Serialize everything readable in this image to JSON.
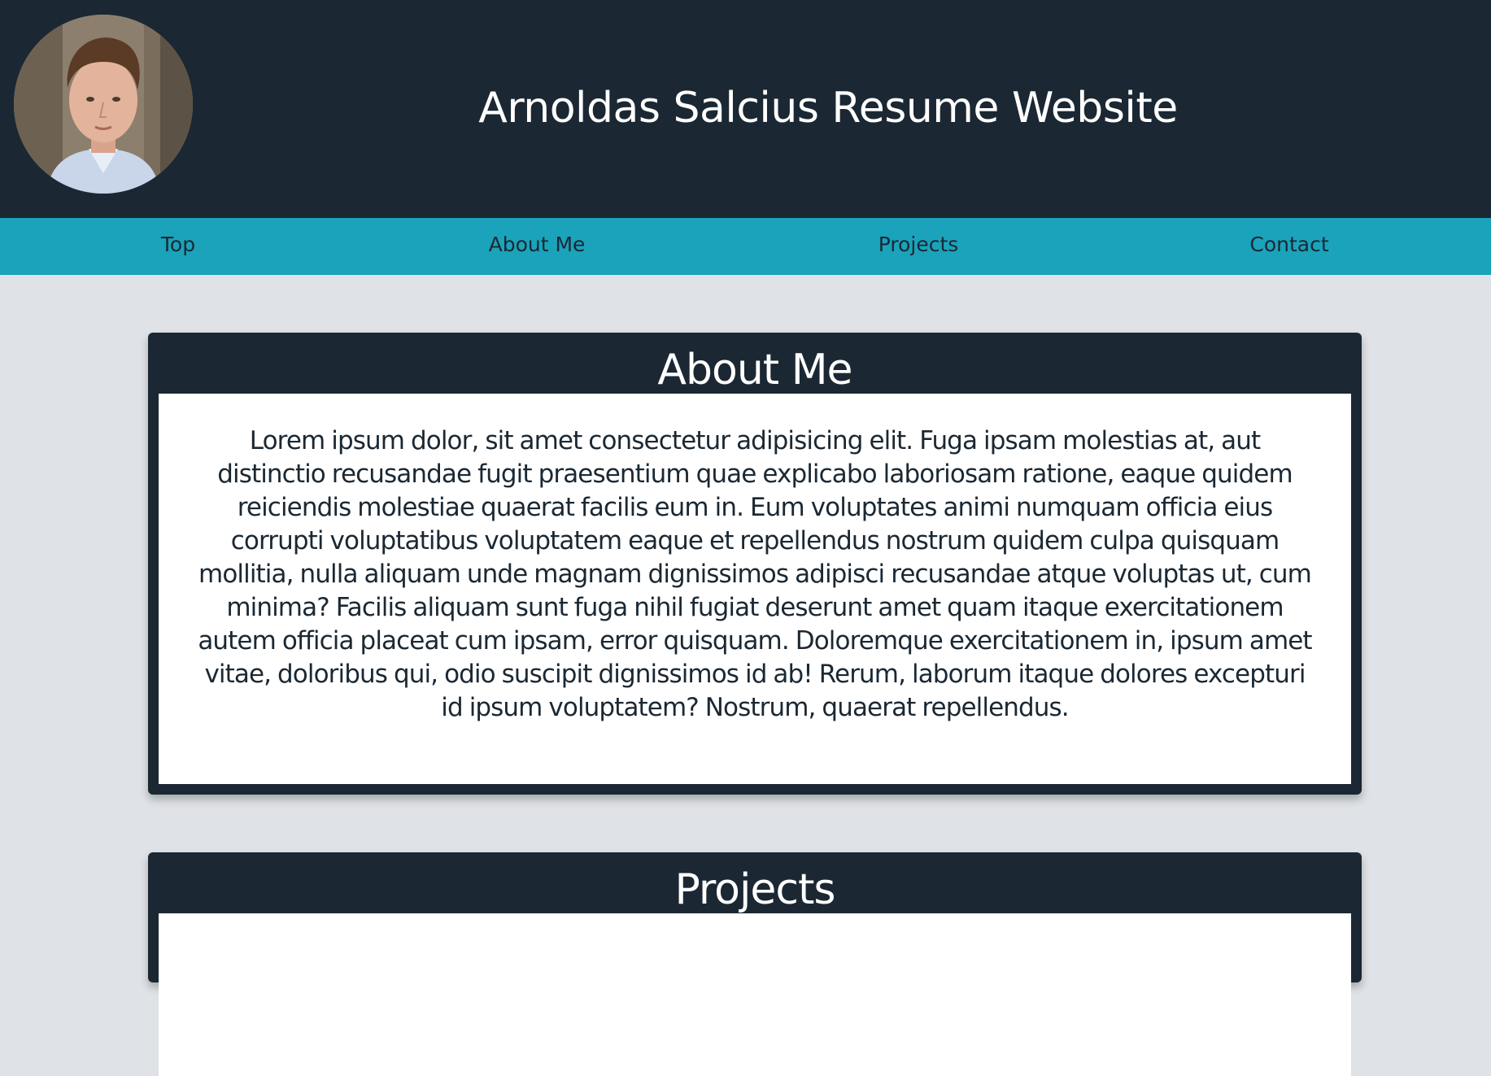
{
  "header": {
    "title": "Arnoldas Salcius Resume Website",
    "avatar_alt": "profile photo"
  },
  "nav": {
    "items": [
      {
        "label": "Top"
      },
      {
        "label": "About Me"
      },
      {
        "label": "Projects"
      },
      {
        "label": "Contact"
      }
    ]
  },
  "about": {
    "title": "About Me",
    "text": "Lorem ipsum dolor, sit amet consectetur adipisicing elit. Fuga ipsam molestias at, aut distinctio recusandae fugit praesentium quae explicabo laboriosam ratione, eaque quidem reiciendis molestiae quaerat facilis eum in. Eum voluptates animi numquam officia eius corrupti voluptatibus voluptatem eaque et repellendus nostrum quidem culpa quisquam mollitia, nulla aliquam unde magnam dignissimos adipisci recusandae atque voluptas ut, cum minima? Facilis aliquam sunt fuga nihil fugiat deserunt amet quam itaque exercitationem autem officia placeat cum ipsam, error quisquam. Doloremque exercitationem in, ipsum amet vitae, doloribus qui, odio suscipit dignissimos id ab! Rerum, laborum itaque dolores excepturi id ipsum voluptatem? Nostrum, quaerat repellendus."
  },
  "projects": {
    "title": "Projects"
  },
  "colors": {
    "header_bg": "#1b2833",
    "nav_bg": "#1aa3bb",
    "page_bg": "#dfe2e6",
    "card_body_bg": "#ffffff"
  }
}
